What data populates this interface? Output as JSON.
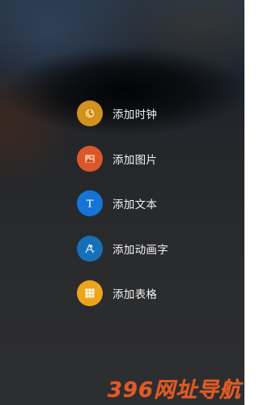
{
  "menu": {
    "items": [
      {
        "label": "添加时钟",
        "icon": "clock-icon",
        "color": "#d2921f"
      },
      {
        "label": "添加图片",
        "icon": "image-icon",
        "color": "#d9582a"
      },
      {
        "label": "添加文本",
        "icon": "text-icon",
        "color": "#1574d6"
      },
      {
        "label": "添加动画字",
        "icon": "animated-text-icon",
        "color": "#1570b8"
      },
      {
        "label": "添加表格",
        "icon": "table-icon",
        "color": "#eda51c"
      }
    ]
  },
  "watermark": {
    "text": "396网址导航"
  }
}
